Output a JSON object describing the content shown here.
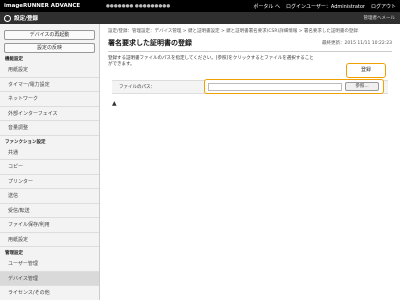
{
  "topbar": {
    "product": "imageRUNNER ADVANCE",
    "host": "●●●●●●● ●●●●●●●●●",
    "portal_link": "ポータル へ",
    "login_user_label": "ログインユーザー：",
    "login_user": "Administrator",
    "logout": "ログアウト"
  },
  "header": {
    "title": "設定/登録",
    "admin_mail": "管理者へメール"
  },
  "sidebar": {
    "buttons": [
      "デバイスの再起動",
      "設定の反映"
    ],
    "section1": "機能設定",
    "items1": [
      "用紙設定",
      "タイマー/電力設定",
      "ネットワーク",
      "外部インターフェイス",
      "音量調整"
    ],
    "section2": "ファンクション設定",
    "items2": [
      "共通",
      "コピー",
      "プリンター",
      "送信",
      "受信/転送",
      "ファイル保存/利用"
    ],
    "item_standalone": "用紙設定",
    "section3": "管理設定",
    "items3": [
      "ユーザー管理",
      "デバイス管理",
      "ライセンス/その他"
    ]
  },
  "main": {
    "breadcrumb": "設定/登録：管理設定：デバイス管理 > 鍵と証明書設定 > 鍵と証明書署名要求(CSR)詳細情報 > 署名要求した証明書の登録",
    "title": "署名要求した証明書の登録",
    "last_updated": "最終更新：2015 11/11 10:22:23",
    "description": "登録する証明書ファイルのパスを指定してください。[参照]をクリックするとファイルを選択することができます。",
    "register_button": "登録",
    "file_path_label": "ファイルのパス：",
    "browse_button": "参照...",
    "file_path_value": "",
    "to_top": "▲"
  }
}
